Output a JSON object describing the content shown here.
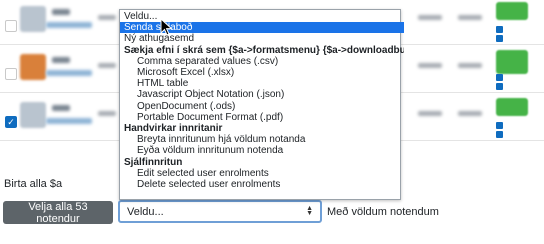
{
  "rows": [
    {
      "checked": false
    },
    {
      "checked": false
    },
    {
      "checked": true
    }
  ],
  "select_all_label": "Birta alla $a",
  "select_all_button": "Velja alla 53 notendur",
  "action_select": {
    "value": "Veldu..."
  },
  "with_selected_label": "Með völdum notendum",
  "dropdown": {
    "options": [
      {
        "label": "Veldu...",
        "kind": "option",
        "level": 0
      },
      {
        "label": "Senda skilaboð",
        "kind": "option",
        "level": 0,
        "highlighted": true
      },
      {
        "label": "Ný athugasemd",
        "kind": "option",
        "level": 0
      },
      {
        "label": "Sækja efni í skrá sem {$a->formatsmenu} {$a->downloadbutton}",
        "kind": "group"
      },
      {
        "label": "Comma separated values (.csv)",
        "kind": "option",
        "level": 1
      },
      {
        "label": "Microsoft Excel (.xlsx)",
        "kind": "option",
        "level": 1
      },
      {
        "label": "HTML table",
        "kind": "option",
        "level": 1
      },
      {
        "label": "Javascript Object Notation (.json)",
        "kind": "option",
        "level": 1
      },
      {
        "label": "OpenDocument (.ods)",
        "kind": "option",
        "level": 1
      },
      {
        "label": "Portable Document Format (.pdf)",
        "kind": "option",
        "level": 1
      },
      {
        "label": "Handvirkar innritanir",
        "kind": "group"
      },
      {
        "label": "Breyta innritunum hjá völdum notanda",
        "kind": "option",
        "level": 1
      },
      {
        "label": "Eyða völdum innritunum notenda",
        "kind": "option",
        "level": 1
      },
      {
        "label": "Sjálfinnritun",
        "kind": "group"
      },
      {
        "label": "Edit selected user enrolments",
        "kind": "option",
        "level": 1
      },
      {
        "label": "Delete selected user enrolments",
        "kind": "option",
        "level": 1
      }
    ]
  },
  "colors": {
    "highlight": "#1a73e8",
    "primary": "#0f6cbf",
    "button_bg": "#5d6469",
    "badge_green": "#45b347",
    "focus_border": "#6f9fd6"
  },
  "icons": {
    "select_arrows": "updown-chevron-icon",
    "cursor": "mouse-pointer-icon",
    "check": "checkmark-icon"
  }
}
